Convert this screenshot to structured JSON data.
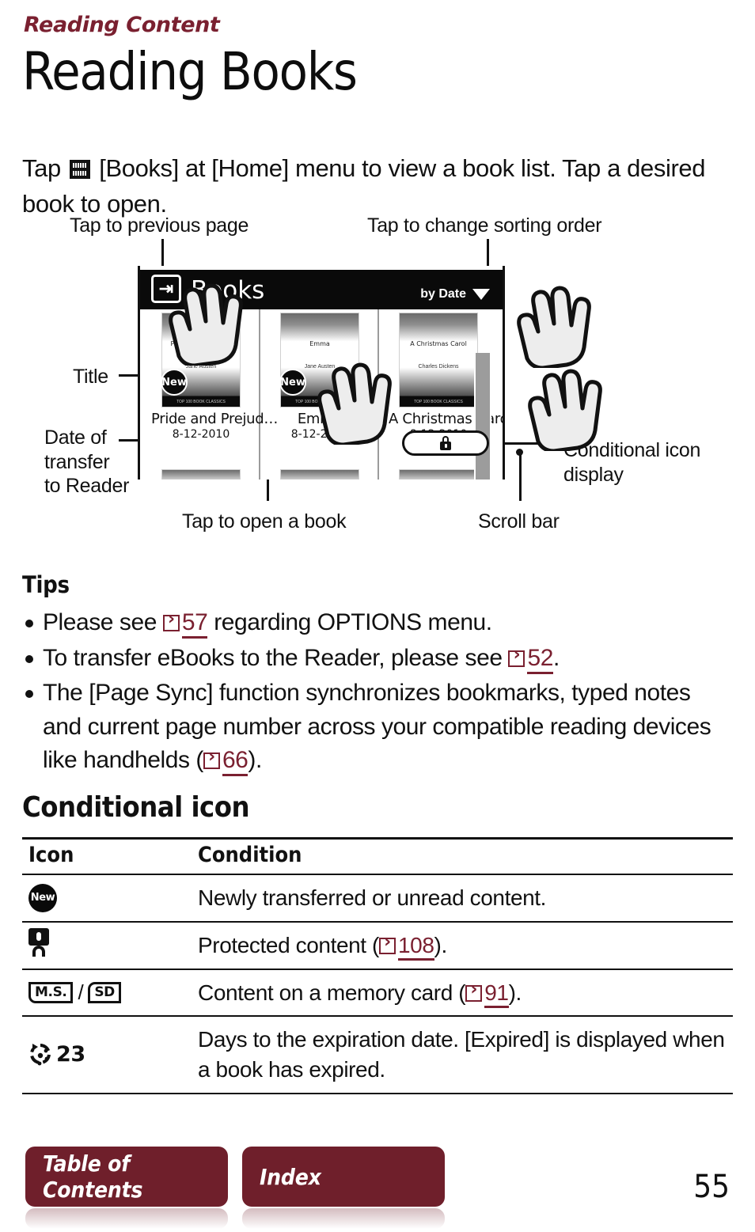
{
  "header": {
    "kicker": "Reading Content",
    "title": "Reading Books",
    "intro_before": "Tap",
    "intro_icon": "bookshelf-icon",
    "intro_after": "[Books] at [Home] menu to view a book list. Tap a desired book to open."
  },
  "figure": {
    "labels": {
      "tap_previous": "Tap to previous page",
      "tap_sorting": "Tap to change sorting order",
      "title": "Title",
      "date_of_transfer": "Date of\ntransfer\nto Reader",
      "tap_open": "Tap to open a book",
      "scroll_bar": "Scroll bar",
      "conditional_icon": "Conditional icon\ndisplay"
    },
    "device": {
      "back_icon": "back-arrow-icon",
      "screen_title": "Books",
      "sort_value": "by Date",
      "sort_caret_icon": "chevron-down-icon",
      "new_badge": "New",
      "books": [
        {
          "cover_title": "Pride and\nPrejudice",
          "cover_author": "Jane Austen",
          "cover_footer": "TOP 100\nBOOK CLASSICS",
          "title": "Pride and Prejud…",
          "date": "8-12-2010",
          "new": true
        },
        {
          "cover_title": "Emma",
          "cover_author": "Jane Austen",
          "cover_footer": "TOP 100\nBOOK CLASSICS",
          "title": "Emma",
          "date": "8-12-2010",
          "new": true
        },
        {
          "cover_title": "A\nChristmas\nCarol",
          "cover_author": "Charles Dickens",
          "cover_footer": "TOP 100\nBOOK CLASSICS",
          "title": "A Christmas Carol",
          "date": "8-12-2010",
          "new": false
        }
      ],
      "callout_icon": "lock-icon",
      "scrollbar_icon": "scroll-bar"
    }
  },
  "tips": {
    "heading": "Tips",
    "items": [
      {
        "pre": "Please see",
        "ref": "57",
        "post": "regarding OPTIONS menu."
      },
      {
        "pre": "To transfer eBooks to the Reader, please see",
        "ref": "52",
        "post": "."
      },
      {
        "pre": "The [Page Sync] function synchronizes bookmarks, typed notes and current page number across your compatible reading devices like handhelds (",
        "ref": "66",
        "post": ")."
      }
    ]
  },
  "conditional": {
    "heading": "Conditional icon",
    "columns": {
      "icon": "Icon",
      "condition": "Condition"
    },
    "rows": [
      {
        "icon": "new-badge-icon",
        "icon_text": "New",
        "text_pre": "Newly transferred or unread content.",
        "ref": "",
        "text_post": ""
      },
      {
        "icon": "lock-icon",
        "icon_text": "",
        "text_pre": "Protected content (",
        "ref": "108",
        "text_post": ")."
      },
      {
        "icon": "memory-card-icon",
        "icon_text": "M.S.",
        "icon_text2": "SD",
        "text_pre": "Content on a memory card (",
        "ref": "91",
        "text_post": ")."
      },
      {
        "icon": "expiration-icon",
        "icon_text": "23",
        "text_pre": "Days to the expiration date. [Expired] is displayed when a book has expired.",
        "ref": "",
        "text_post": ""
      }
    ]
  },
  "footer": {
    "toc_label": "Table of Contents",
    "index_label": "Index",
    "page_number": "55"
  },
  "colors": {
    "accent": "#7a2030",
    "button": "#6f1f2b",
    "text": "#111111"
  }
}
